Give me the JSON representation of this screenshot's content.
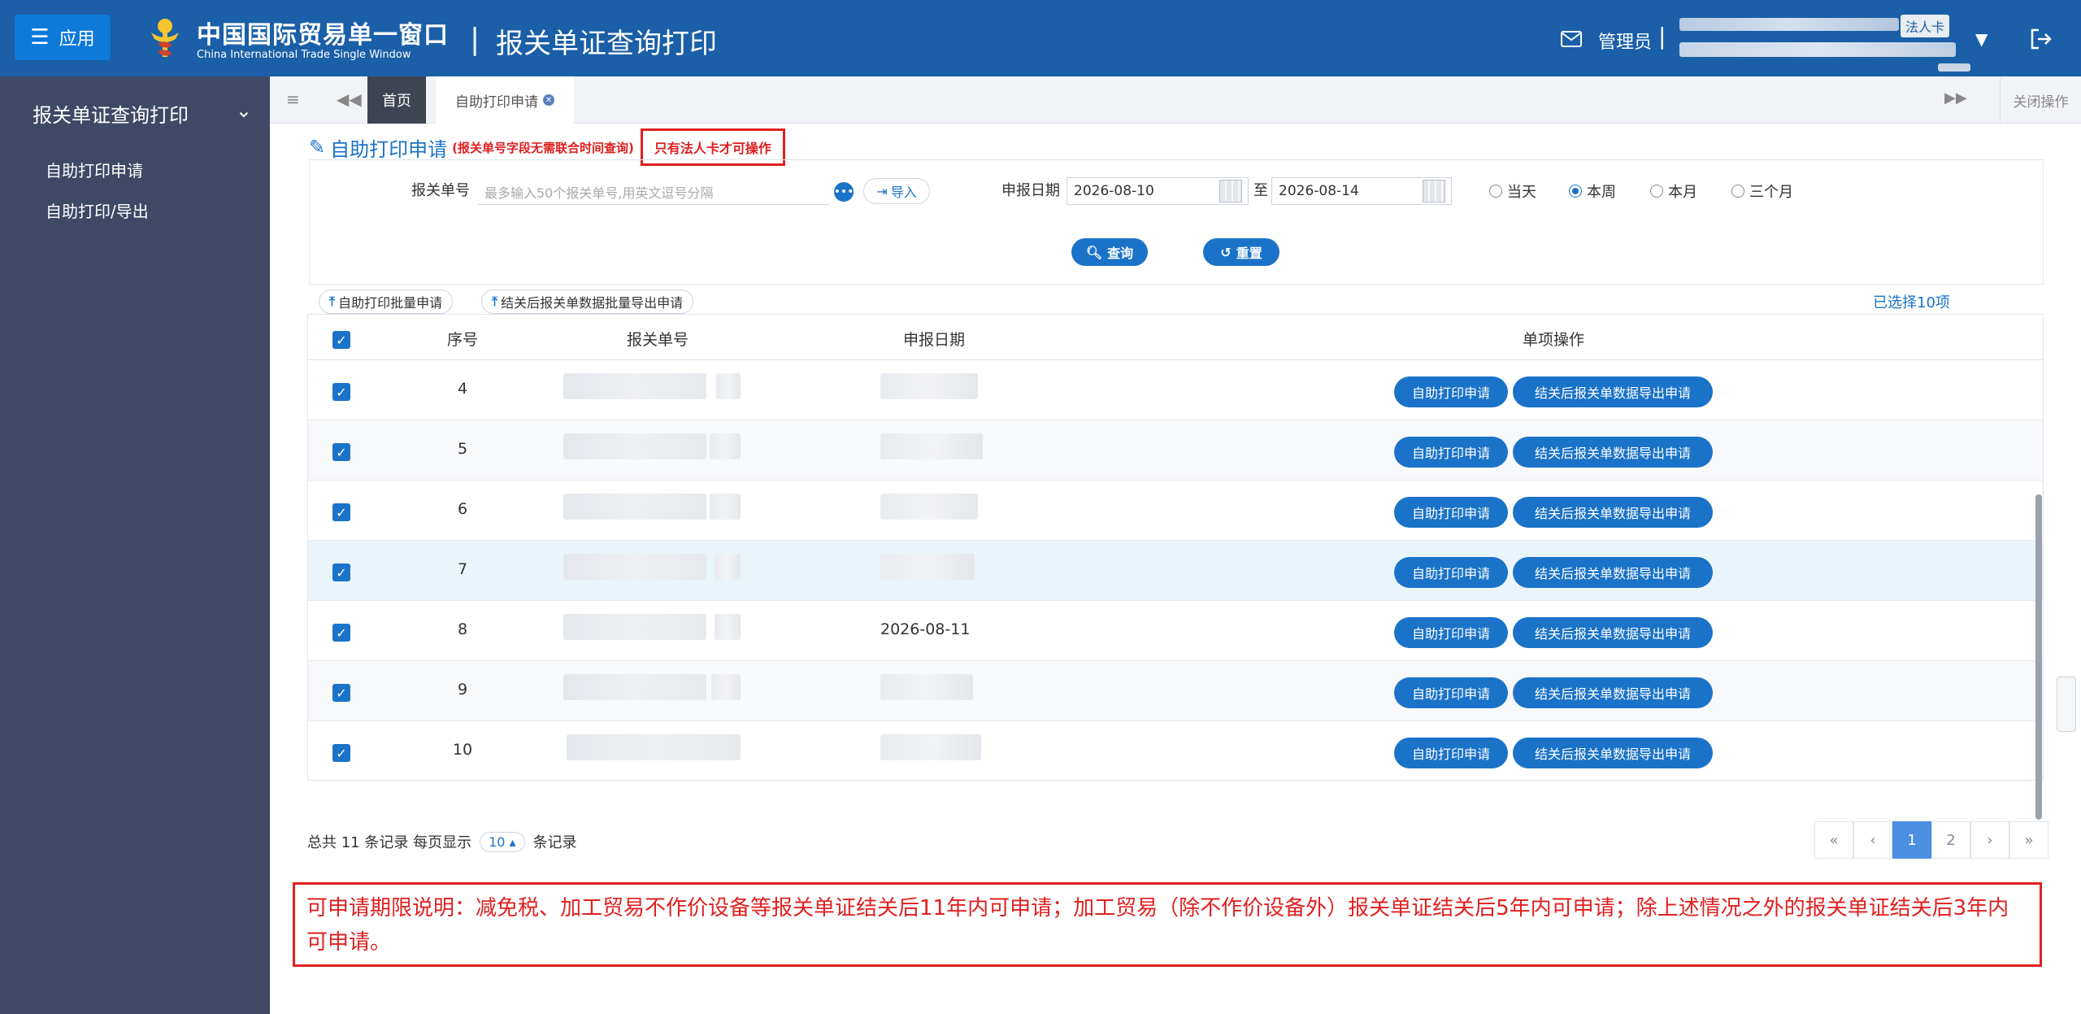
{
  "header": {
    "app_label": "应用",
    "logo_title": "中国国际贸易单一窗口",
    "logo_subtitle": "China International Trade Single Window",
    "divider": "|",
    "page_title": "报关单证查询打印",
    "admin_label": "管理员",
    "admin_sep": "|",
    "legal_badge": "法人卡",
    "brand_color": "#1a5fa8"
  },
  "sidebar": {
    "group_label": "报关单证查询打印",
    "items": [
      {
        "label": "自助打印申请"
      },
      {
        "label": "自助打印/导出"
      }
    ]
  },
  "tabs": {
    "home": "首页",
    "current": "自助打印申请",
    "close_ops": "关闭操作"
  },
  "panel": {
    "title": "自助打印申请",
    "note": "(报关单号字段无需联合时间查询)",
    "warning": "只有法人卡才可操作"
  },
  "form": {
    "decl_no_label": "报关单号",
    "decl_no_placeholder": "最多输入50个报关单号,用英文逗号分隔",
    "import_label": "导入",
    "date_label": "申报日期",
    "date_from": "2026-08-10",
    "to_label": "至",
    "date_to": "2026-08-14",
    "radios": [
      {
        "label": "当天",
        "checked": false
      },
      {
        "label": "本周",
        "checked": true
      },
      {
        "label": "本月",
        "checked": false
      },
      {
        "label": "三个月",
        "checked": false
      }
    ],
    "search_label": "查询",
    "reset_label": "重置"
  },
  "toolbar": {
    "batch_print_label": "自助打印批量申请",
    "batch_export_label": "结关后报关单数据批量导出申请",
    "selected_text": "已选择10项"
  },
  "table": {
    "headers": [
      "序号",
      "报关单号",
      "申报日期",
      "单项操作"
    ],
    "rows": [
      {
        "seq": "4",
        "date": "",
        "checked": true
      },
      {
        "seq": "5",
        "date": "",
        "checked": true
      },
      {
        "seq": "6",
        "date": "",
        "checked": true
      },
      {
        "seq": "7",
        "date": "",
        "checked": true
      },
      {
        "seq": "8",
        "date": "2026-08-11",
        "checked": true
      },
      {
        "seq": "9",
        "date": "",
        "checked": true
      },
      {
        "seq": "10",
        "date": "",
        "checked": true
      }
    ],
    "action1_label": "自助打印申请",
    "action2_label": "结关后报关单数据导出申请"
  },
  "pager": {
    "total_prefix": "总共 11 条记录 每页显示",
    "page_size": "10",
    "total_suffix": "条记录",
    "pages": [
      "1",
      "2"
    ],
    "current_page": "1"
  },
  "notice": {
    "text": "可申请期限说明：减免税、加工贸易不作价设备等报关单证结关后11年内可申请；加工贸易（除不作价设备外）报关单证结关后5年内可申请；除上述情况之外的报关单证结关后3年内可申请。"
  }
}
